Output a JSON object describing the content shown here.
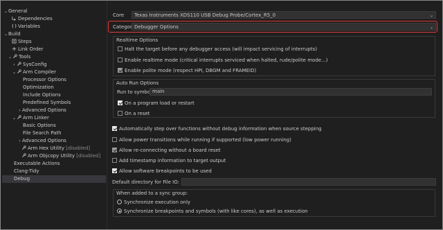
{
  "sidebar": {
    "general": "General",
    "dependencies": "Dependencies",
    "variables": "Variables",
    "build": "Build",
    "steps": "Steps",
    "link_order": "Link Order",
    "tools": "Tools",
    "sysconfig": "SysConfig",
    "arm_compiler": "Arm Compiler",
    "processor_options": "Processor Options",
    "optimization": "Optimization",
    "include_options": "Include Options",
    "predefined_symbols": "Predefined Symbols",
    "compiler_advanced_options": "Advanced Options",
    "arm_linker": "Arm Linker",
    "basic_options": "Basic Options",
    "file_search_path": "File Search Path",
    "linker_advanced_options": "Advanced Options",
    "arm_hex_utility": "Arm Hex Utility",
    "arm_hex_utility_state": "[disabled]",
    "arm_objcopy_utility": "Arm Objcopy Utility",
    "arm_objcopy_utility_state": "[disabled]",
    "executable_actions": "Executable Actions",
    "clang_tidy": "Clang-Tidy",
    "debug": "Debug"
  },
  "core": {
    "label": "Core",
    "value": "Texas Instruments XDS110 USB Debug Probe/Cortex_R5_0"
  },
  "category": {
    "label": "Category",
    "value": "Debugger Options"
  },
  "realtime_options": {
    "title": "Realtime Options",
    "halt_target": "Halt the target before any debugger access (will impact servicing of interrupts)",
    "enable_realtime": "Enable realtime mode (critical interrupts serviced when halted, rude/polite mode...)",
    "enable_polite": "Enable polite mode (respect HPI, DBGM and FRAMEID)"
  },
  "auto_run": {
    "title": "Auto Run Options",
    "run_to_symbol_label": "Run to symbol",
    "run_to_symbol_value": "main",
    "on_program_load": "On a program load or restart",
    "on_reset": "On a reset"
  },
  "options": {
    "auto_step_over": "Automatically step over functions without debug information when source stepping",
    "power_transitions": "Allow power transitions while running if supported (low power running)",
    "reconnecting": "Allow re-connecting without a board reset",
    "timestamp": "Add timestamp information to target output",
    "sw_breakpoints": "Allow software breakpoints to be used"
  },
  "file_io": {
    "label": "Default directory for File IO:",
    "value": ""
  },
  "sync_group": {
    "title": "When added to a sync group:",
    "sync_execution": "Synchronize execution only",
    "sync_breakpoints": "Synchronize breakpoints and symbols (with like cores), as well as execution"
  },
  "colors": {
    "background": "#1f1f1f",
    "highlight": "#e53935",
    "selected_row": "#37373d"
  }
}
